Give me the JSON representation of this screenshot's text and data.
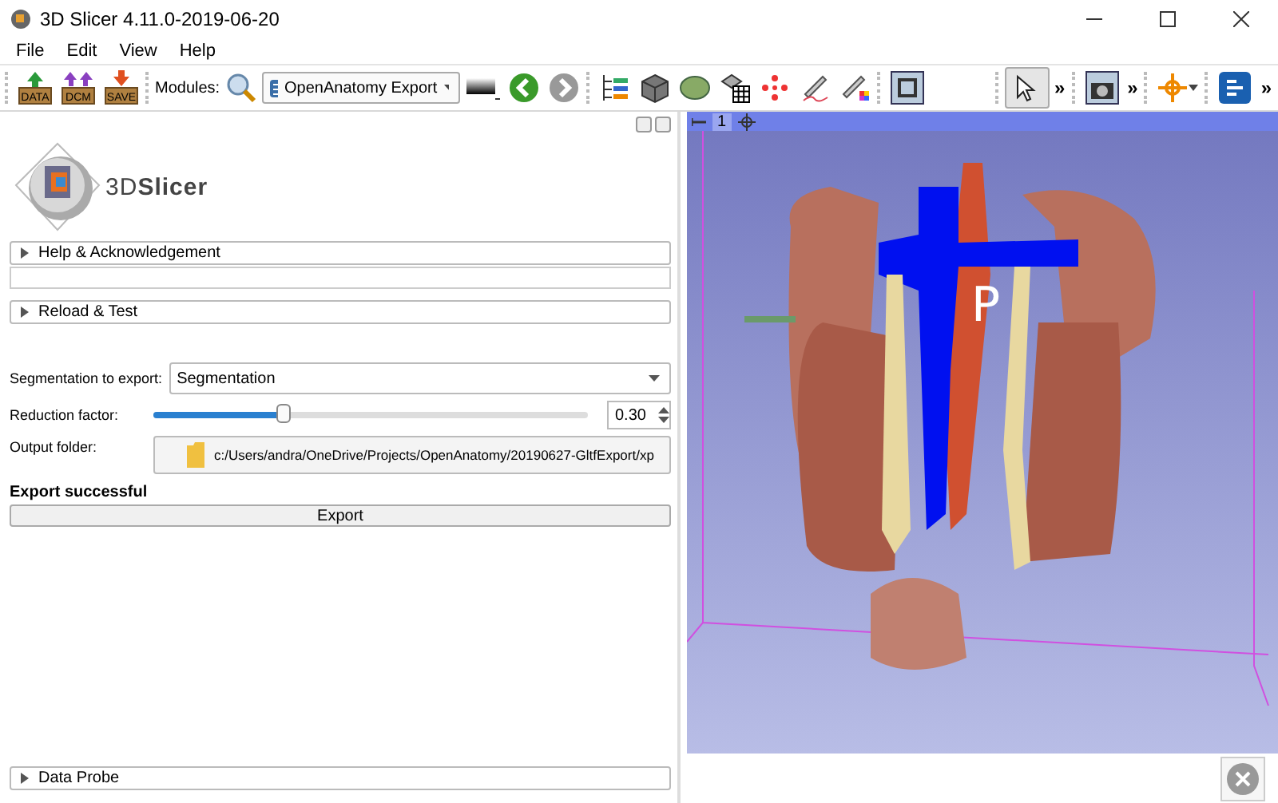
{
  "window": {
    "title": "3D Slicer 4.11.0-2019-06-20"
  },
  "menu": [
    "File",
    "Edit",
    "View",
    "Help"
  ],
  "toolbar": {
    "items": [
      {
        "kind": "grip"
      },
      {
        "kind": "data",
        "label": "DATA",
        "selected": false
      },
      {
        "kind": "dcm",
        "label": "DCM",
        "selected": false
      },
      {
        "kind": "save",
        "label": "SAVE",
        "selected": false
      },
      {
        "kind": "grip"
      },
      {
        "kind": "text",
        "text": "Modules:"
      },
      {
        "kind": "search",
        "selected": false
      },
      {
        "kind": "module_select",
        "text": "OpenAnatomy Export"
      },
      {
        "kind": "color_bar",
        "selected": false
      },
      {
        "kind": "back",
        "selected": false
      },
      {
        "kind": "forward",
        "selected": false
      },
      {
        "kind": "grip"
      },
      {
        "kind": "hierarchy",
        "selected": false
      },
      {
        "kind": "cube",
        "selected": false
      },
      {
        "kind": "model",
        "selected": false
      },
      {
        "kind": "grid",
        "selected": false
      },
      {
        "kind": "dots",
        "selected": false
      },
      {
        "kind": "pen",
        "selected": false
      },
      {
        "kind": "pen_colors",
        "selected": false
      },
      {
        "kind": "grip"
      },
      {
        "kind": "frame",
        "selected": false
      },
      {
        "kind": "spacer"
      },
      {
        "kind": "grip"
      },
      {
        "kind": "pointer",
        "selected": true
      },
      {
        "kind": "more",
        "text": "»"
      },
      {
        "kind": "grip"
      },
      {
        "kind": "camera",
        "selected": false
      },
      {
        "kind": "more",
        "text": "»"
      },
      {
        "kind": "grip"
      },
      {
        "kind": "crosshair",
        "selected": false
      },
      {
        "kind": "grip"
      },
      {
        "kind": "extensions",
        "selected": false
      },
      {
        "kind": "more",
        "text": "»"
      }
    ]
  },
  "panel": {
    "logo": "3D**Slicer**",
    "sections": [
      {
        "title": "Help & Acknowledgement",
        "expanded": false
      },
      {
        "title": "Reload & Test",
        "expanded": false
      }
    ],
    "segmentation": {
      "label": "Segmentation to export:",
      "value": "Segmentation"
    },
    "reduction": {
      "label": "Reduction factor:",
      "level": 0.3,
      "reading": "0.30"
    },
    "output": {
      "label": "Output folder:",
      "path": "c:/Users/andra/OneDrive/Projects/OpenAnatomy/20190627-GltfExport/xp"
    },
    "status": "Export successful",
    "export_button": "Export",
    "data_probe": {
      "title": "Data Probe",
      "expanded": false
    }
  },
  "view": {
    "number": "1",
    "orientation_label": "P"
  }
}
